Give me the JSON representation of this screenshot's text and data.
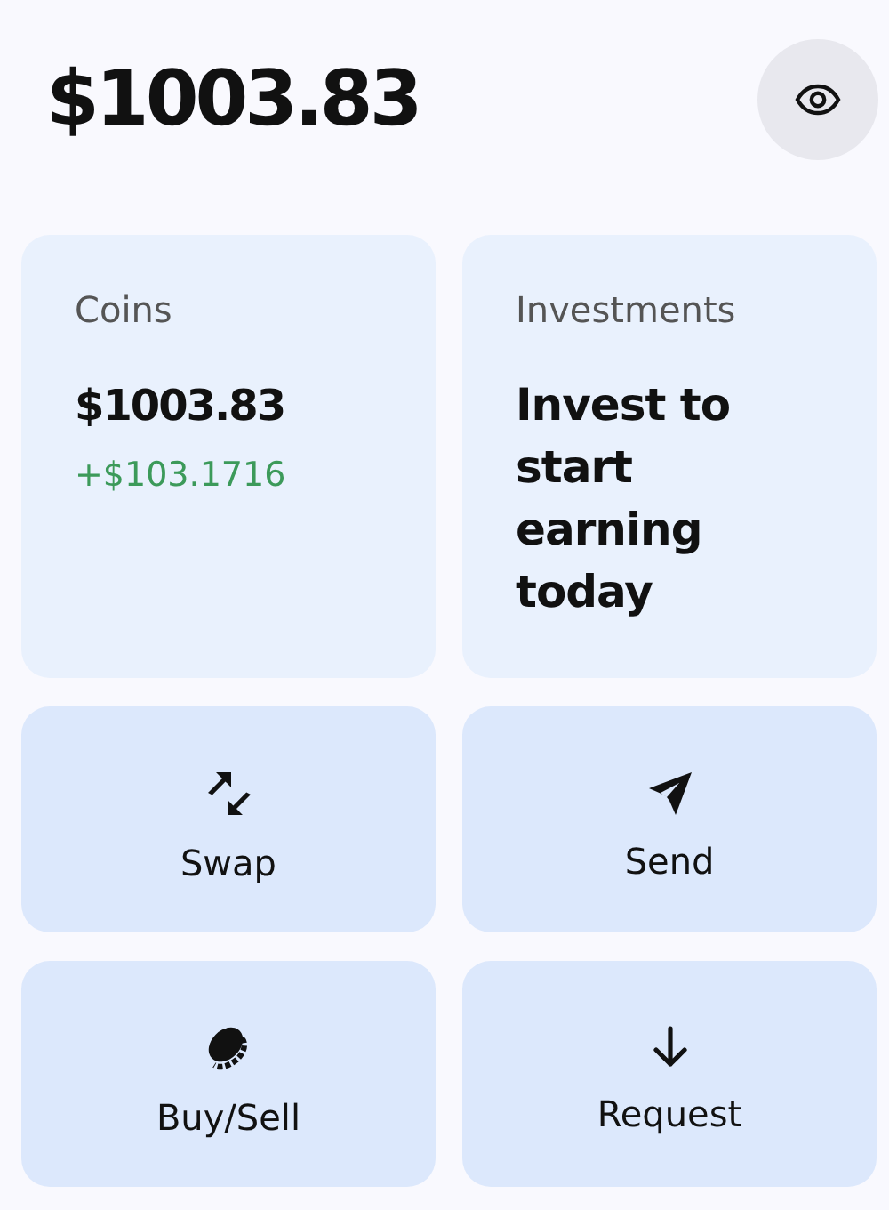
{
  "balance": "$1003.83",
  "coins": {
    "title": "Coins",
    "amount": "$1003.83",
    "change": "+$103.1716"
  },
  "investments": {
    "title": "Investments",
    "message": "Invest to start earning today"
  },
  "actions": [
    {
      "kind": "swap",
      "label": "Swap"
    },
    {
      "kind": "send",
      "label": "Send"
    },
    {
      "kind": "coin",
      "label": "Buy/Sell"
    },
    {
      "kind": "request",
      "label": "Request"
    }
  ]
}
